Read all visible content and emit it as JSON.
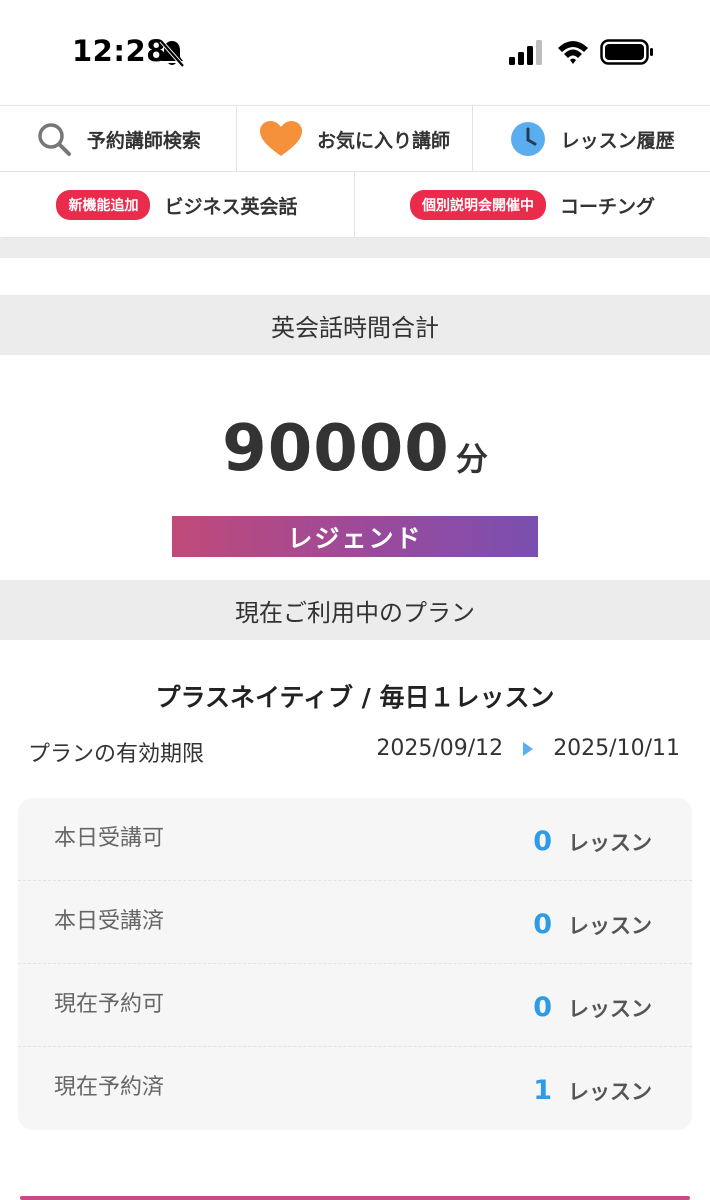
{
  "status_bar": {
    "time": "12:28"
  },
  "nav": {
    "row1": [
      {
        "label": "予約講師検索",
        "icon": "search-icon"
      },
      {
        "label": "お気に入り講師",
        "icon": "heart-icon"
      },
      {
        "label": "レッスン履歴",
        "icon": "clock-icon"
      }
    ],
    "row2": [
      {
        "badge": "新機能追加",
        "label": "ビジネス英会話"
      },
      {
        "badge": "個別説明会開催中",
        "label": "コーチング"
      }
    ]
  },
  "colors": {
    "badge": "#ea2b4b",
    "accent_blue": "#2e9be6",
    "rank_gradient_start": "#c04a78",
    "rank_gradient_end": "#7a4fb0"
  },
  "total": {
    "header": "英会話時間合計",
    "value": "90000",
    "unit": "分",
    "rank": "レジェンド"
  },
  "plan": {
    "header": "現在ご利用中のプラン",
    "name": "プラスネイティブ / 毎日１レッスン",
    "validity_label": "プランの有効期限",
    "start_date": "2025/09/12",
    "end_date": "2025/10/11"
  },
  "lessons": [
    {
      "label": "本日受講可",
      "count": "0",
      "unit": "レッスン"
    },
    {
      "label": "本日受講済",
      "count": "0",
      "unit": "レッスン"
    },
    {
      "label": "現在予約可",
      "count": "0",
      "unit": "レッスン"
    },
    {
      "label": "現在予約済",
      "count": "1",
      "unit": "レッスン"
    }
  ]
}
